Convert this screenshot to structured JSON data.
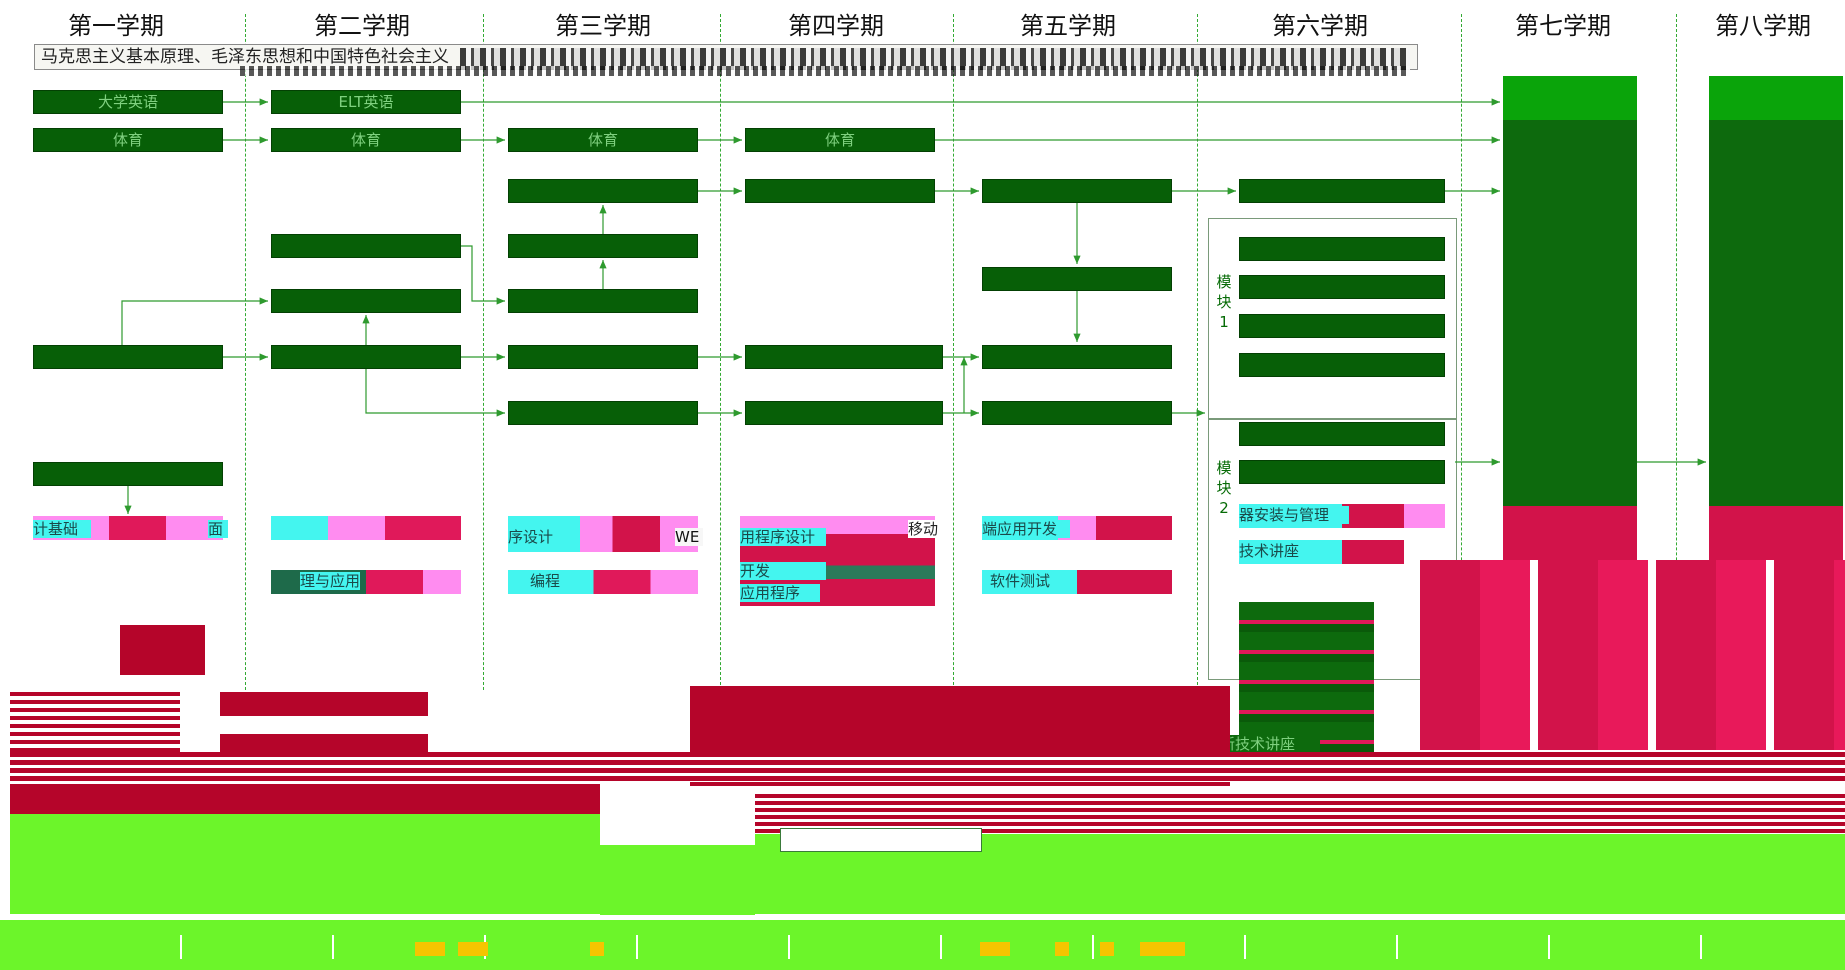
{
  "semesters": [
    "第一学期",
    "第二学期",
    "第三学期",
    "第四学期",
    "第五学期",
    "第六学期",
    "第七学期",
    "第八学期"
  ],
  "banner_text": "马克思主义基本原理、毛泽东思想和中国特色社会主义",
  "courses": {
    "s1_english": "大学英语",
    "s2_english": "ELT英语",
    "pe": "体育",
    "s1_fragment": "计基础",
    "s1_fragment2": "面",
    "s2_fragment": "理与应用",
    "s3_fragment": "序设计",
    "s3_fragment2": "编程",
    "s4_fragment": "用程序设计",
    "s4_fragment2": "开发",
    "s4_fragment3": "应用程序",
    "s4_web": "WE",
    "s5_fragment": "端应用开发",
    "s5_mobile": "移动",
    "s5_test": "软件测试",
    "s6_item1": "器安装与管理",
    "s6_item2": "技术讲座",
    "s6_item3": "新技术讲座"
  },
  "module_labels": [
    "模块1",
    "模块2"
  ],
  "colors": {
    "course_box": "#075f07",
    "module_border": "#7a9a7a",
    "arrow": "#2e9a2e",
    "highlight_cyan": "#44f5ef",
    "band_red": "#d2134a",
    "noise_green": "#6cf52a"
  }
}
